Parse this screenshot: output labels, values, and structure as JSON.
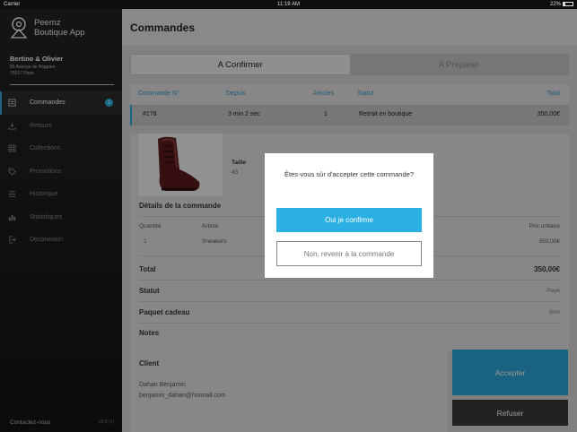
{
  "status_bar": {
    "carrier": "Carrier",
    "time": "11:19 AM",
    "battery": "22%"
  },
  "sidebar": {
    "app_name_line1": "Peemz",
    "app_name_line2": "Boutique App",
    "store_name": "Bertino & Olivier",
    "store_address_line1": "85 Avenue de Wagram",
    "store_address_line2": "75017 Paris",
    "items": [
      {
        "label": "Commandes",
        "icon": "orders-icon",
        "active": true,
        "badge": "1"
      },
      {
        "label": "Retours",
        "icon": "returns-icon"
      },
      {
        "label": "Collections",
        "icon": "collections-icon"
      },
      {
        "label": "Promotions",
        "icon": "tag-icon"
      },
      {
        "label": "Historique",
        "icon": "list-icon"
      },
      {
        "label": "Statistiques",
        "icon": "bar-chart-icon"
      },
      {
        "label": "Déconexion",
        "icon": "logout-icon"
      }
    ],
    "contact": "Contactez-nous",
    "version": "v0.9 (1)"
  },
  "main": {
    "title": "Commandes",
    "tabs": [
      {
        "label": "A Confirmer",
        "selected": true
      },
      {
        "label": "A Preparer",
        "selected": false
      }
    ],
    "table": {
      "headers": [
        "Commande N°",
        "Depuis",
        "Articles",
        "Statut",
        "Total"
      ],
      "row": {
        "id": "#178",
        "since": "3 min 2 sec",
        "articles": "1",
        "status": "Retrait en boutique",
        "total": "350,00€"
      }
    },
    "product": {
      "size_label": "Taille",
      "size_value": "43"
    },
    "details": {
      "title": "Détails de la commande",
      "col_qty": "Quantité",
      "col_article": "Article",
      "col_unit_price": "Prix unitaire",
      "line_qty": "1",
      "line_article": "Sneakers",
      "line_price": "350,00€",
      "total_label": "Total",
      "total_value": "350,00€",
      "statut_label": "Statut",
      "statut_value": "Payé",
      "gift_label": "Paquet cadeau",
      "gift_value": "Non",
      "notes_label": "Notes"
    },
    "client": {
      "title": "Client",
      "name": "Dahan Benjamin",
      "email": "benjamin_dahan@hotmail.com"
    },
    "accept_label": "Accepter",
    "refuse_label": "Refuser"
  },
  "modal": {
    "question": "Êtes-vous sûr d'accepter cette commande?",
    "confirm_label": "Oui je confirme",
    "cancel_label": "Non, revenir à la commande"
  },
  "colors": {
    "accent": "#2bb0e3",
    "sidebar_bg": "#1c1c1c",
    "refuse_bg": "#3a3a3a"
  }
}
